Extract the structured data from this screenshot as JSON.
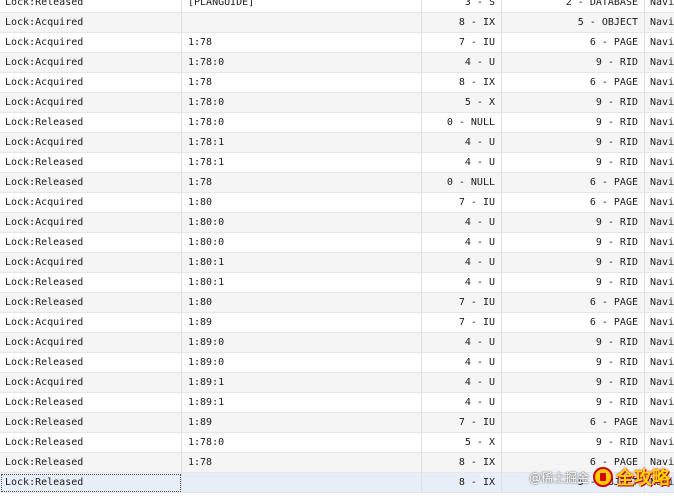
{
  "rows": [
    {
      "c0": "Lock:Released",
      "c1": "[PLANGUIDE]",
      "c2": "3 - S",
      "c3": "2 - DATABASE",
      "c4": "Navi"
    },
    {
      "c0": "Lock:Acquired",
      "c1": "",
      "c2": "8 - IX",
      "c3": "5 - OBJECT",
      "c4": "Navi"
    },
    {
      "c0": "Lock:Acquired",
      "c1": "1:78",
      "c2": "7 - IU",
      "c3": "6 - PAGE",
      "c4": "Navi"
    },
    {
      "c0": "Lock:Acquired",
      "c1": "1:78:0",
      "c2": "4 - U",
      "c3": "9 - RID",
      "c4": "Navi"
    },
    {
      "c0": "Lock:Acquired",
      "c1": "1:78",
      "c2": "8 - IX",
      "c3": "6 - PAGE",
      "c4": "Navi"
    },
    {
      "c0": "Lock:Acquired",
      "c1": "1:78:0",
      "c2": "5 - X",
      "c3": "9 - RID",
      "c4": "Navi"
    },
    {
      "c0": "Lock:Released",
      "c1": "1:78:0",
      "c2": "0 - NULL",
      "c3": "9 - RID",
      "c4": "Navi"
    },
    {
      "c0": "Lock:Acquired",
      "c1": "1:78:1",
      "c2": "4 - U",
      "c3": "9 - RID",
      "c4": "Navi"
    },
    {
      "c0": "Lock:Released",
      "c1": "1:78:1",
      "c2": "4 - U",
      "c3": "9 - RID",
      "c4": "Navi"
    },
    {
      "c0": "Lock:Released",
      "c1": "1:78",
      "c2": "0 - NULL",
      "c3": "6 - PAGE",
      "c4": "Navi"
    },
    {
      "c0": "Lock:Acquired",
      "c1": "1:80",
      "c2": "7 - IU",
      "c3": "6 - PAGE",
      "c4": "Navi"
    },
    {
      "c0": "Lock:Acquired",
      "c1": "1:80:0",
      "c2": "4 - U",
      "c3": "9 - RID",
      "c4": "Navi"
    },
    {
      "c0": "Lock:Released",
      "c1": "1:80:0",
      "c2": "4 - U",
      "c3": "9 - RID",
      "c4": "Navi"
    },
    {
      "c0": "Lock:Acquired",
      "c1": "1:80:1",
      "c2": "4 - U",
      "c3": "9 - RID",
      "c4": "Navi"
    },
    {
      "c0": "Lock:Released",
      "c1": "1:80:1",
      "c2": "4 - U",
      "c3": "9 - RID",
      "c4": "Navi"
    },
    {
      "c0": "Lock:Released",
      "c1": "1:80",
      "c2": "7 - IU",
      "c3": "6 - PAGE",
      "c4": "Navi"
    },
    {
      "c0": "Lock:Acquired",
      "c1": "1:89",
      "c2": "7 - IU",
      "c3": "6 - PAGE",
      "c4": "Navi"
    },
    {
      "c0": "Lock:Acquired",
      "c1": "1:89:0",
      "c2": "4 - U",
      "c3": "9 - RID",
      "c4": "Navi"
    },
    {
      "c0": "Lock:Released",
      "c1": "1:89:0",
      "c2": "4 - U",
      "c3": "9 - RID",
      "c4": "Navi"
    },
    {
      "c0": "Lock:Acquired",
      "c1": "1:89:1",
      "c2": "4 - U",
      "c3": "9 - RID",
      "c4": "Navi"
    },
    {
      "c0": "Lock:Released",
      "c1": "1:89:1",
      "c2": "4 - U",
      "c3": "9 - RID",
      "c4": "Navi"
    },
    {
      "c0": "Lock:Released",
      "c1": "1:89",
      "c2": "7 - IU",
      "c3": "6 - PAGE",
      "c4": "Navi"
    },
    {
      "c0": "Lock:Released",
      "c1": "1:78:0",
      "c2": "5 - X",
      "c3": "9 - RID",
      "c4": "Navi"
    },
    {
      "c0": "Lock:Released",
      "c1": "1:78",
      "c2": "8 - IX",
      "c3": "6 - PAGE",
      "c4": "Navi"
    },
    {
      "c0": "Lock:Released",
      "c1": "",
      "c2": "8 - IX",
      "c3": "5 - OBJECT",
      "c4": "Navi"
    }
  ],
  "watermark": {
    "sub": "@稀土掘金",
    "main": "全攻略"
  },
  "colors": {
    "row_alt": "#f5f5f5",
    "row_selected": "#e8eef7",
    "grid_line": "#e0e0e0"
  }
}
